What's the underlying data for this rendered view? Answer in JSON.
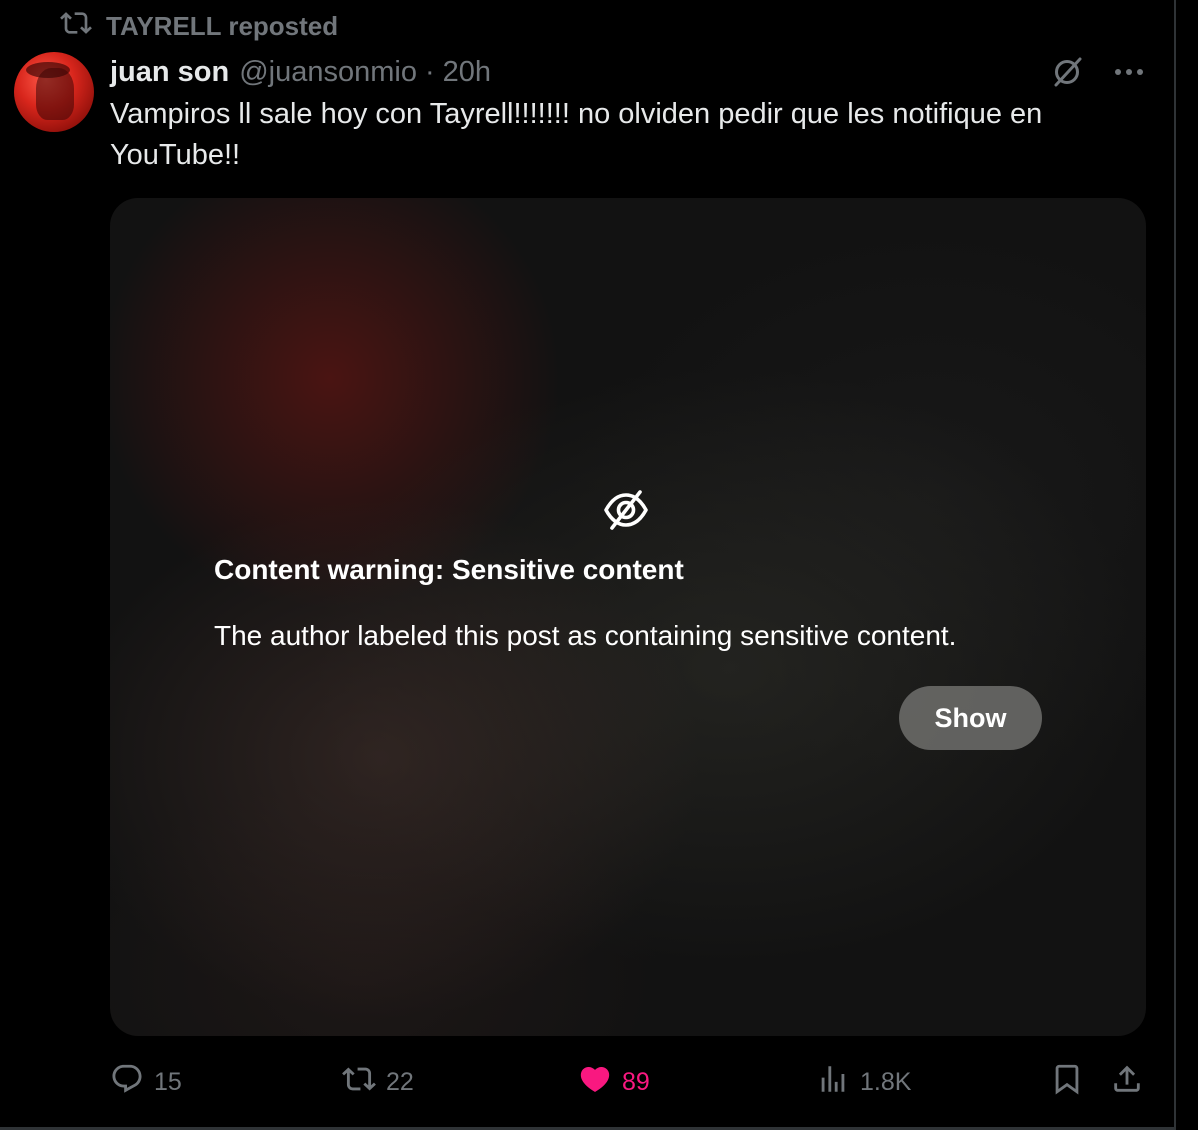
{
  "repost_banner": {
    "icon": "repost-icon",
    "text": "TAYRELL reposted"
  },
  "author": {
    "name": "juan son",
    "handle": "@juansonmio",
    "separator": "·",
    "time": "20h",
    "avatar_color": "#d8261c"
  },
  "top_icons": [
    "grok-slash-icon",
    "more-icon"
  ],
  "post": {
    "text": "Vampiros ll sale hoy con Tayrell!!!!!!! no olviden pedir que les notifique en YouTube!!"
  },
  "media": {
    "warning_icon": "eye-slash-icon",
    "warning_title": "Content warning: Sensitive content",
    "warning_body": "The author labeled this post as containing sensitive content.",
    "show_label": "Show"
  },
  "actions": {
    "reply": {
      "icon": "reply-icon",
      "count": "15"
    },
    "repost": {
      "icon": "repost-icon",
      "count": "22"
    },
    "like": {
      "icon": "heart-filled-icon",
      "count": "89",
      "color": "#f91880"
    },
    "views": {
      "icon": "views-icon",
      "count": "1.8K"
    },
    "bookmark": {
      "icon": "bookmark-icon"
    },
    "share": {
      "icon": "share-icon"
    }
  },
  "colors": {
    "background": "#000000",
    "text": "#e7e9ea",
    "muted": "#71767b",
    "like": "#f91880"
  }
}
